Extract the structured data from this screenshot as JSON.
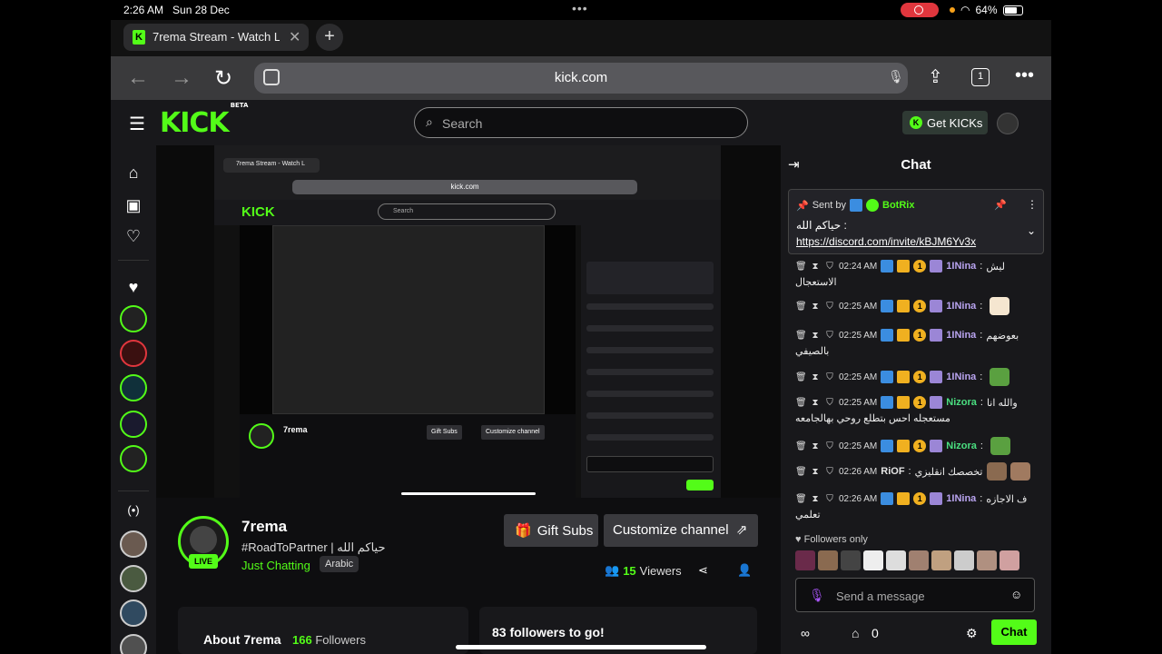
{
  "os": {
    "time": "2:26 AM",
    "date": "Sun 28 Dec",
    "battery": "64%"
  },
  "browser": {
    "tab_title": "7rema Stream - Watch L",
    "url": "kick.com",
    "tab_count": "1"
  },
  "header": {
    "logo": "KICK",
    "logo_beta": "BETA",
    "search_placeholder": "Search",
    "get_kicks": "Get KICKs"
  },
  "stream": {
    "name": "7rema",
    "title": "#RoadToPartner | حياكم الله",
    "category": "Just Chatting",
    "language": "Arabic",
    "live": "LIVE",
    "viewers_count": "15",
    "viewers_label": "Viewers",
    "gift_subs": "Gift Subs",
    "customize": "Customize channel",
    "about_label": "About 7rema",
    "followers_count": "166",
    "followers_label": "Followers",
    "goal": "83 followers to go!"
  },
  "chat": {
    "title": "Chat",
    "pinned": {
      "sent_by": "Sent by",
      "user": "BotRix",
      "text": "حياكم الله :",
      "link": "https://discord.com/invite/kBJM6Yv3x"
    },
    "messages": [
      {
        "time": "02:24 AM",
        "user": "1INina",
        "color": "#b9a4f0",
        "text": "ليش",
        "text2": "الاستعجال"
      },
      {
        "time": "02:25 AM",
        "user": "1INina",
        "color": "#b9a4f0",
        "text": "",
        "text2": ""
      },
      {
        "time": "02:25 AM",
        "user": "1INina",
        "color": "#b9a4f0",
        "text": "بعوضهم",
        "text2": "بالصيفي"
      },
      {
        "time": "02:25 AM",
        "user": "1INina",
        "color": "#b9a4f0",
        "text": "",
        "text2": ""
      },
      {
        "time": "02:25 AM",
        "user": "Nizora",
        "color": "#4ade80",
        "text": "والله انا",
        "text2": "مستعجله احس بتطلع روحي بهالجامعه"
      },
      {
        "time": "02:25 AM",
        "user": "Nizora",
        "color": "#4ade80",
        "text": "",
        "text2": ""
      },
      {
        "time": "02:26 AM",
        "user": "RiOF",
        "color": "#e5e5e5",
        "text": "تخصصك انقليزي",
        "text2": ""
      },
      {
        "time": "02:26 AM",
        "user": "1INina",
        "color": "#b9a4f0",
        "text": "ف الاجازه",
        "text2": "تعلمي"
      }
    ],
    "followers_only": "Followers only",
    "send_placeholder": "Send a message",
    "points": "0",
    "chat_button": "Chat"
  },
  "icons": [
    "home-icon",
    "browse-icon",
    "heart-icon",
    "hamburger-icon",
    "search-icon",
    "mic-icon",
    "share-icon",
    "settings-icon"
  ]
}
